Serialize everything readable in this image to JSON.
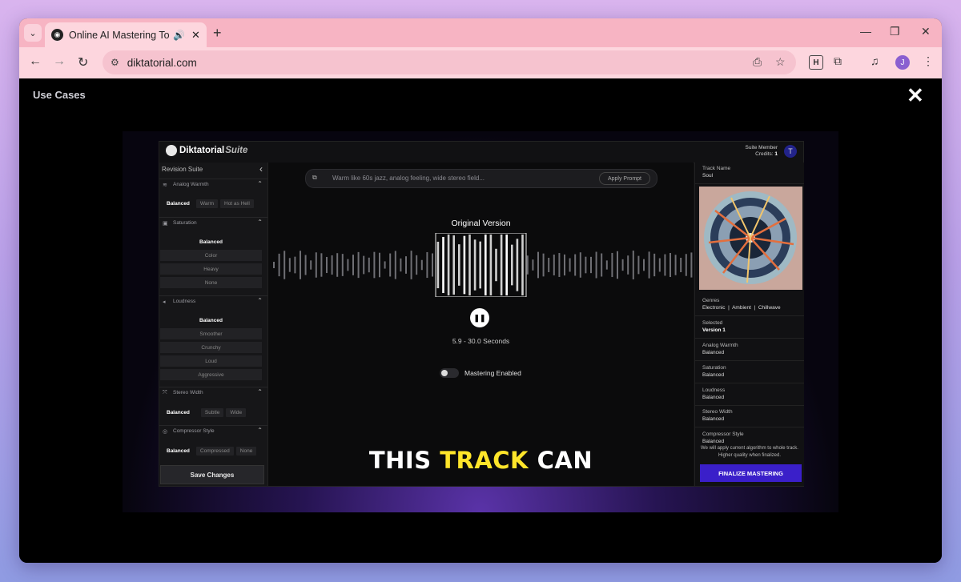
{
  "browser": {
    "tab_title": "Online AI Mastering Tool fo",
    "url": "diktatorial.com",
    "new_tab": "+",
    "avatar_initial": "J",
    "ext_letter": "H"
  },
  "overlay": {
    "section_title": "Use Cases",
    "close_label": "✕"
  },
  "app": {
    "logo": "Diktatorial",
    "logo_suffix": "Suite",
    "member_label": "Suite Member",
    "credits_label": "Credits:",
    "credits_value": "1",
    "member_initial": "T",
    "left": {
      "title": "Revision Suite",
      "sections": {
        "analog_warmth": {
          "label": "Analog Warmth",
          "options": [
            "Balanced",
            "Warm",
            "Hot as Hell"
          ],
          "selected": "Balanced"
        },
        "saturation": {
          "label": "Saturation",
          "options": [
            "Balanced",
            "Color",
            "Heavy",
            "None"
          ],
          "selected": "Balanced"
        },
        "loudness": {
          "label": "Loudness",
          "options": [
            "Balanced",
            "Smoother",
            "Crunchy",
            "Loud",
            "Aggressive"
          ],
          "selected": "Balanced"
        },
        "stereo_width": {
          "label": "Stereo Width",
          "options": [
            "Balanced",
            "Subtle",
            "Wide"
          ],
          "selected": "Balanced"
        },
        "compressor_style": {
          "label": "Compressor Style",
          "options": [
            "Balanced",
            "Compressed",
            "None"
          ],
          "selected": "Balanced"
        }
      },
      "save_label": "Save Changes"
    },
    "center": {
      "prompt_placeholder": "Warm like 60s jazz, analog feeling, wide stereo field...",
      "apply_label": "Apply Prompt",
      "version_title": "Original Version",
      "range": "5.9 - 30.0 Seconds",
      "mastering_label": "Mastering Enabled",
      "mastering_enabled": false,
      "caption_a": "THIS",
      "caption_b": "TRACK",
      "caption_c": "CAN"
    },
    "right": {
      "track_name_label": "Track Name",
      "track_name": "Soul",
      "genres_label": "Genres",
      "genres": "Electronic  |  Ambient  |  Chillwave",
      "selected_label": "Selected",
      "selected_value": "Version 1",
      "analog_label": "Analog Warmth",
      "analog_value": "Balanced",
      "saturation_label": "Saturation",
      "saturation_value": "Balanced",
      "loudness_label": "Loudness",
      "loudness_value": "Balanced",
      "stereo_label": "Stereo Width",
      "stereo_value": "Balanced",
      "compressor_label": "Compressor Style",
      "compressor_value": "Balanced",
      "note": "We will apply current algorithm to whole track. Higher quality when finalized.",
      "finalize_label": "FINALIZE MASTERING"
    }
  },
  "colors": {
    "accent": "#3a1fc9",
    "caption_highlight": "#ffe52a",
    "tab_bar": "#f7b4c3"
  }
}
